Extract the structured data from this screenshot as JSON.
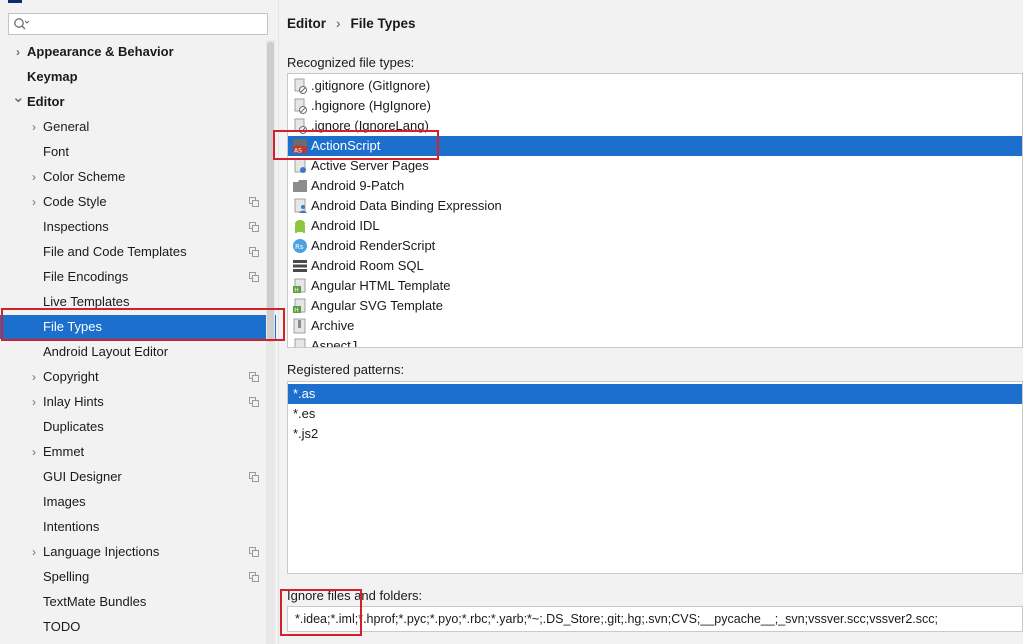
{
  "search": {
    "placeholder": ""
  },
  "sidebar": {
    "items": [
      {
        "label": "Appearance & Behavior",
        "level": 0,
        "expander": "right",
        "copy_icon": false,
        "selected": false
      },
      {
        "label": "Keymap",
        "level": 0,
        "expander": "none",
        "copy_icon": false,
        "selected": false
      },
      {
        "label": "Editor",
        "level": 0,
        "expander": "down",
        "copy_icon": false,
        "selected": false
      },
      {
        "label": "General",
        "level": 1,
        "expander": "right",
        "copy_icon": false,
        "selected": false
      },
      {
        "label": "Font",
        "level": 1,
        "expander": "none",
        "copy_icon": false,
        "selected": false
      },
      {
        "label": "Color Scheme",
        "level": 1,
        "expander": "right",
        "copy_icon": false,
        "selected": false
      },
      {
        "label": "Code Style",
        "level": 1,
        "expander": "right",
        "copy_icon": true,
        "selected": false
      },
      {
        "label": "Inspections",
        "level": 1,
        "expander": "none",
        "copy_icon": true,
        "selected": false
      },
      {
        "label": "File and Code Templates",
        "level": 1,
        "expander": "none",
        "copy_icon": true,
        "selected": false
      },
      {
        "label": "File Encodings",
        "level": 1,
        "expander": "none",
        "copy_icon": true,
        "selected": false
      },
      {
        "label": "Live Templates",
        "level": 1,
        "expander": "none",
        "copy_icon": false,
        "selected": false
      },
      {
        "label": "File Types",
        "level": 1,
        "expander": "none",
        "copy_icon": false,
        "selected": true
      },
      {
        "label": "Android Layout Editor",
        "level": 1,
        "expander": "none",
        "copy_icon": false,
        "selected": false
      },
      {
        "label": "Copyright",
        "level": 1,
        "expander": "right",
        "copy_icon": true,
        "selected": false
      },
      {
        "label": "Inlay Hints",
        "level": 1,
        "expander": "right",
        "copy_icon": true,
        "selected": false
      },
      {
        "label": "Duplicates",
        "level": 1,
        "expander": "none",
        "copy_icon": false,
        "selected": false
      },
      {
        "label": "Emmet",
        "level": 1,
        "expander": "right",
        "copy_icon": false,
        "selected": false
      },
      {
        "label": "GUI Designer",
        "level": 1,
        "expander": "none",
        "copy_icon": true,
        "selected": false
      },
      {
        "label": "Images",
        "level": 1,
        "expander": "none",
        "copy_icon": false,
        "selected": false
      },
      {
        "label": "Intentions",
        "level": 1,
        "expander": "none",
        "copy_icon": false,
        "selected": false
      },
      {
        "label": "Language Injections",
        "level": 1,
        "expander": "right",
        "copy_icon": true,
        "selected": false
      },
      {
        "label": "Spelling",
        "level": 1,
        "expander": "none",
        "copy_icon": true,
        "selected": false
      },
      {
        "label": "TextMate Bundles",
        "level": 1,
        "expander": "none",
        "copy_icon": false,
        "selected": false
      },
      {
        "label": "TODO",
        "level": 1,
        "expander": "none",
        "copy_icon": false,
        "selected": false
      }
    ]
  },
  "breadcrumb": {
    "parent": "Editor",
    "separator": "›",
    "current": "File Types"
  },
  "recognized": {
    "label": "Recognized file types:",
    "items": [
      {
        "label": ".gitignore (GitIgnore)",
        "icon": "ignore-file-icon",
        "selected": false
      },
      {
        "label": ".hgignore (HgIgnore)",
        "icon": "ignore-file-icon",
        "selected": false
      },
      {
        "label": ".ignore (IgnoreLang)",
        "icon": "ignore-file-icon",
        "selected": false
      },
      {
        "label": "ActionScript",
        "icon": "actionscript-icon",
        "selected": true
      },
      {
        "label": "Active Server Pages",
        "icon": "asp-file-icon",
        "selected": false
      },
      {
        "label": "Android 9-Patch",
        "icon": "folder-icon",
        "selected": false
      },
      {
        "label": "Android Data Binding Expression",
        "icon": "data-binding-icon",
        "selected": false
      },
      {
        "label": "Android IDL",
        "icon": "android-icon",
        "selected": false
      },
      {
        "label": "Android RenderScript",
        "icon": "renderscript-icon",
        "selected": false
      },
      {
        "label": "Android Room SQL",
        "icon": "sql-icon",
        "selected": false
      },
      {
        "label": "Angular HTML Template",
        "icon": "html-template-icon",
        "selected": false
      },
      {
        "label": "Angular SVG Template",
        "icon": "html-template-icon",
        "selected": false
      },
      {
        "label": "Archive",
        "icon": "archive-icon",
        "selected": false
      },
      {
        "label": "AspectJ",
        "icon": "aspectj-icon",
        "selected": false
      }
    ]
  },
  "patterns": {
    "label": "Registered patterns:",
    "items": [
      {
        "label": "*.as",
        "selected": true
      },
      {
        "label": "*.es",
        "selected": false
      },
      {
        "label": "*.js2",
        "selected": false
      }
    ]
  },
  "ignore": {
    "label": "Ignore files and folders:",
    "value": "*.idea;*.iml;*.hprof;*.pyc;*.pyo;*.rbc;*.yarb;*~;.DS_Store;.git;.hg;.svn;CVS;__pycache__;_svn;vssver.scc;vssver2.scc;"
  },
  "colors": {
    "selection": "#1c6fcc",
    "highlight_box": "#d4202a",
    "background": "#f2f2f2"
  }
}
